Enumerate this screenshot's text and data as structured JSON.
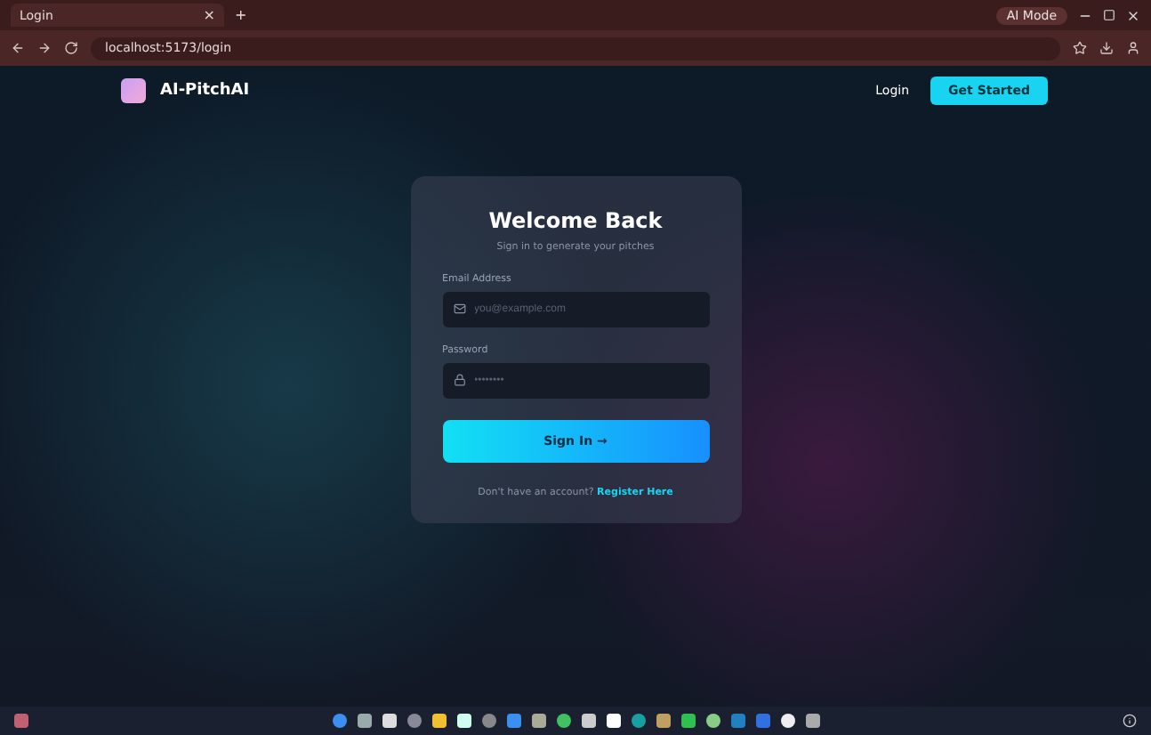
{
  "browser": {
    "tab_title": "Login",
    "tab_close": "×",
    "new_tab": "+",
    "url": "localhost:5173/login",
    "profile": "AI Mode"
  },
  "header": {
    "brand": "AI-PitchAI",
    "login": "Login",
    "cta": "Get Started"
  },
  "card": {
    "title": "Welcome Back",
    "subtitle": "Sign in to generate your pitches",
    "fields": [
      {
        "label": "Email Address",
        "placeholder": "you@example.com",
        "kind": "email"
      },
      {
        "label": "Password",
        "placeholder": "••••••••",
        "kind": "password"
      }
    ],
    "submit": "Sign In →",
    "footer_text": "Don't have an account?",
    "footer_link": "Register Here"
  }
}
